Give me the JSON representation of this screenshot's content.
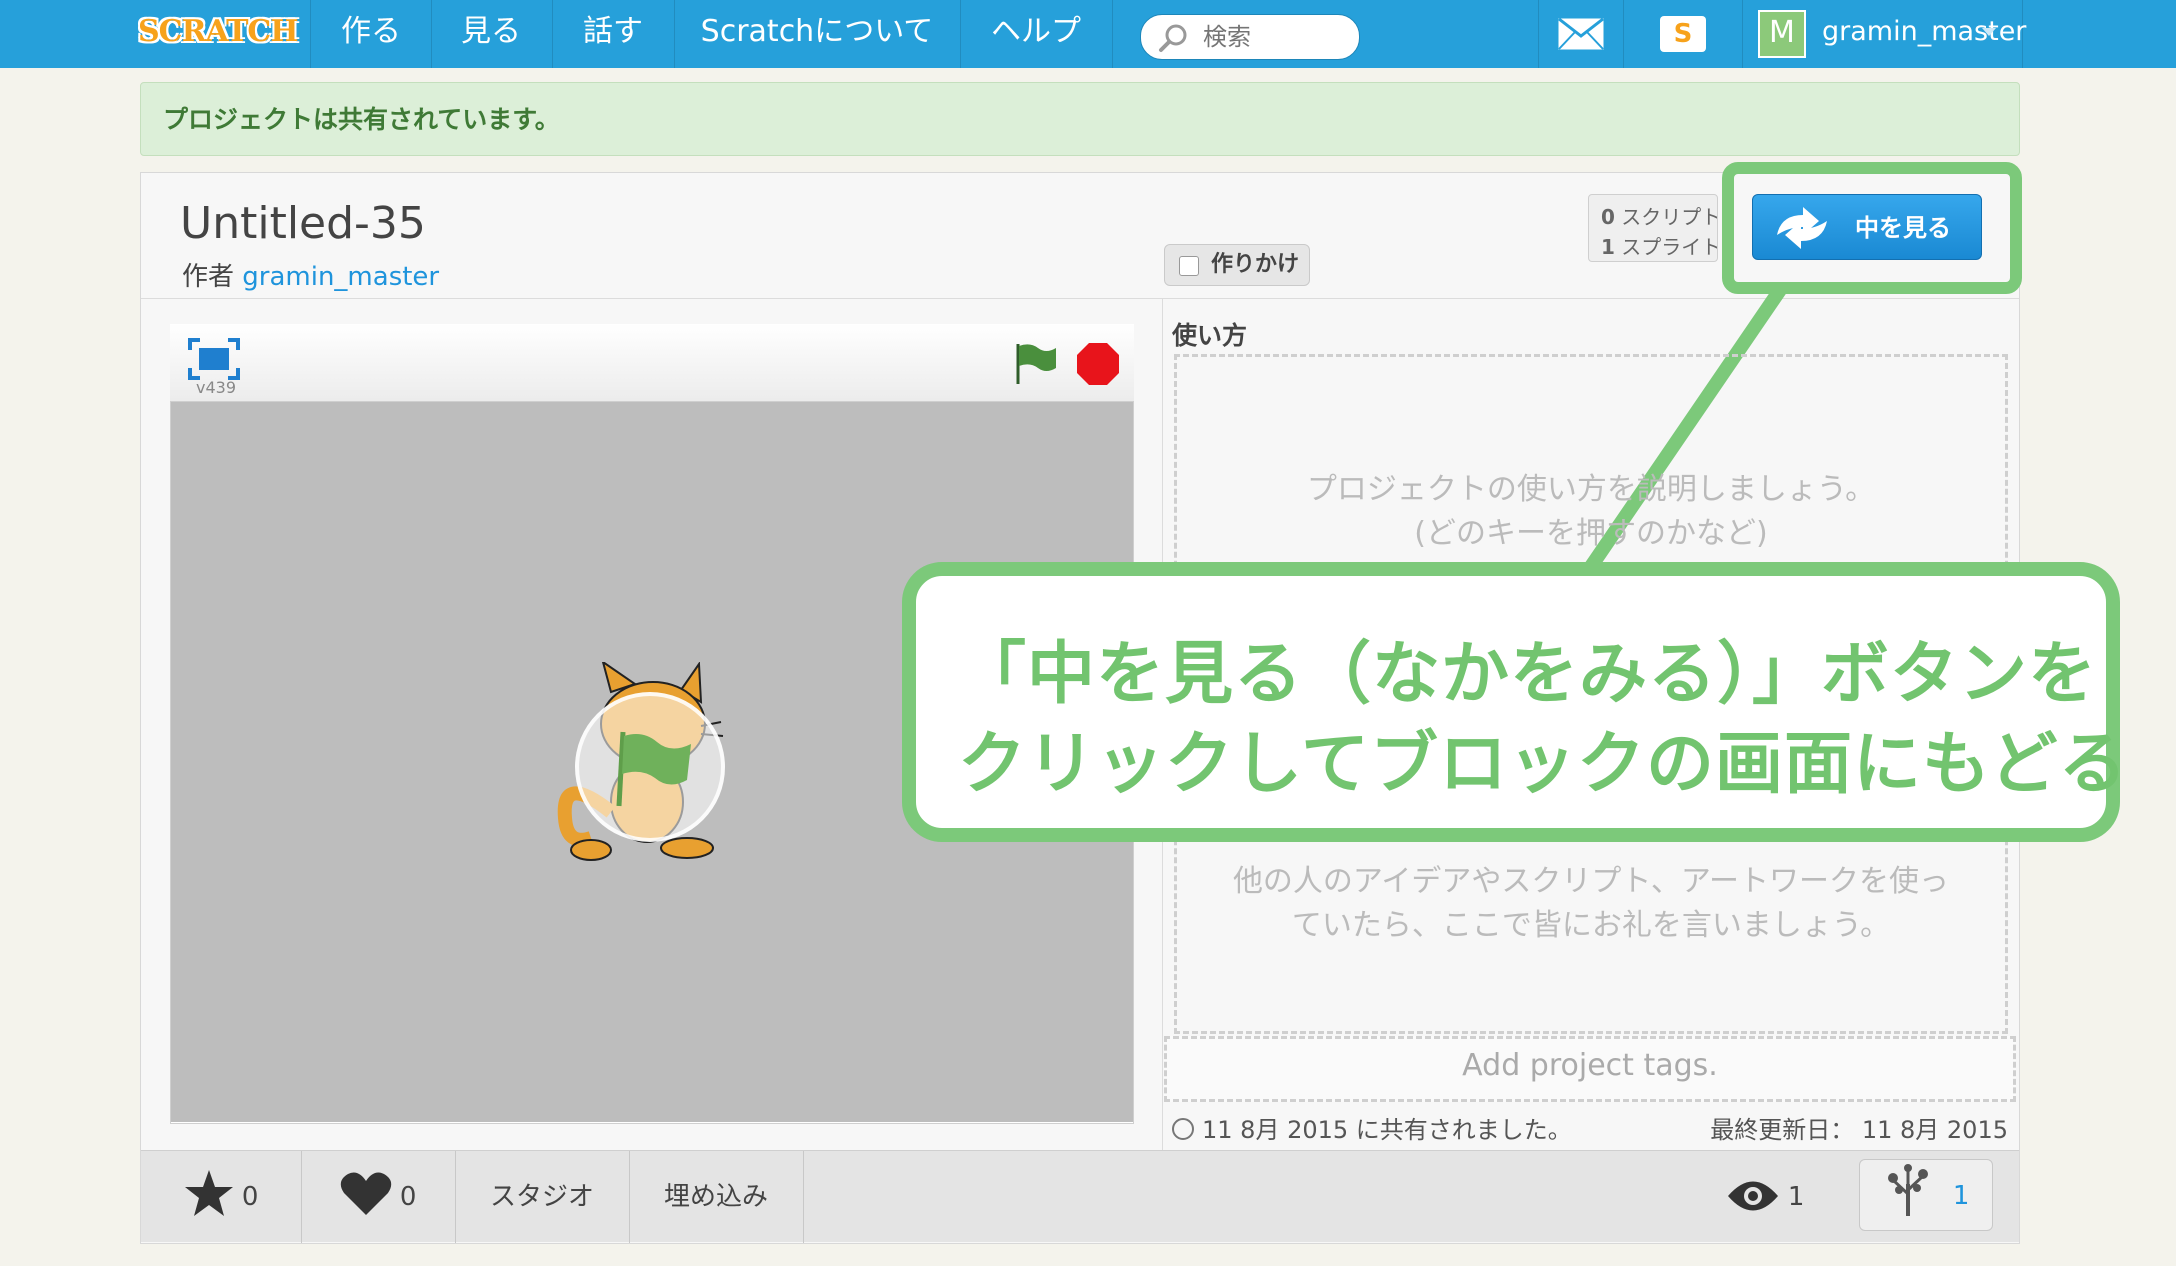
{
  "nav": {
    "logo": "SCRATCH",
    "items": [
      "作る",
      "見る",
      "話す",
      "Scratchについて",
      "ヘルプ"
    ],
    "search_placeholder": "検索",
    "username": "gramin_master",
    "avatar_letter": "M",
    "bag_letter": "S"
  },
  "alert": "プロジェクトは共有されています。",
  "project": {
    "title": "Untitled-35",
    "author_label": "作者",
    "author": "gramin_master",
    "draft_label": "作りかけ",
    "scripts_count": "0",
    "scripts_label": "スクリプト",
    "sprites_count": "1",
    "sprites_label": "スプライト",
    "see_inside": "中を見る",
    "version": "v439"
  },
  "instructions": {
    "heading": "使い方",
    "placeholder_line1": "プロジェクトの使い方を説明しましょう。",
    "placeholder_line2": "(どのキーを押すのかなど)"
  },
  "credits": {
    "placeholder_line1": "他の人のアイデアやスクリプト、アートワークを使っ",
    "placeholder_line2": "ていたら、ここで皆にお礼を言いましょう。"
  },
  "tags_placeholder": "Add project tags.",
  "dates": {
    "shared": "11 8月 2015 に共有されました。",
    "modified_label": "最終更新日：",
    "modified": "11 8月 2015"
  },
  "bottom": {
    "favorites": "0",
    "loves": "0",
    "studio": "スタジオ",
    "embed": "埋め込み",
    "views": "1",
    "remixes": "1"
  },
  "callout": {
    "line1": "「中を見る（なかをみる）」ボタンを",
    "line2": "クリックしてブロックの画面にもどる"
  },
  "colors": {
    "nav": "#26a0da",
    "accent_green": "#7cc97a",
    "button_blue": "#1f94dc",
    "stop_red": "#e8141b",
    "flag_green": "#4a8f3d"
  }
}
